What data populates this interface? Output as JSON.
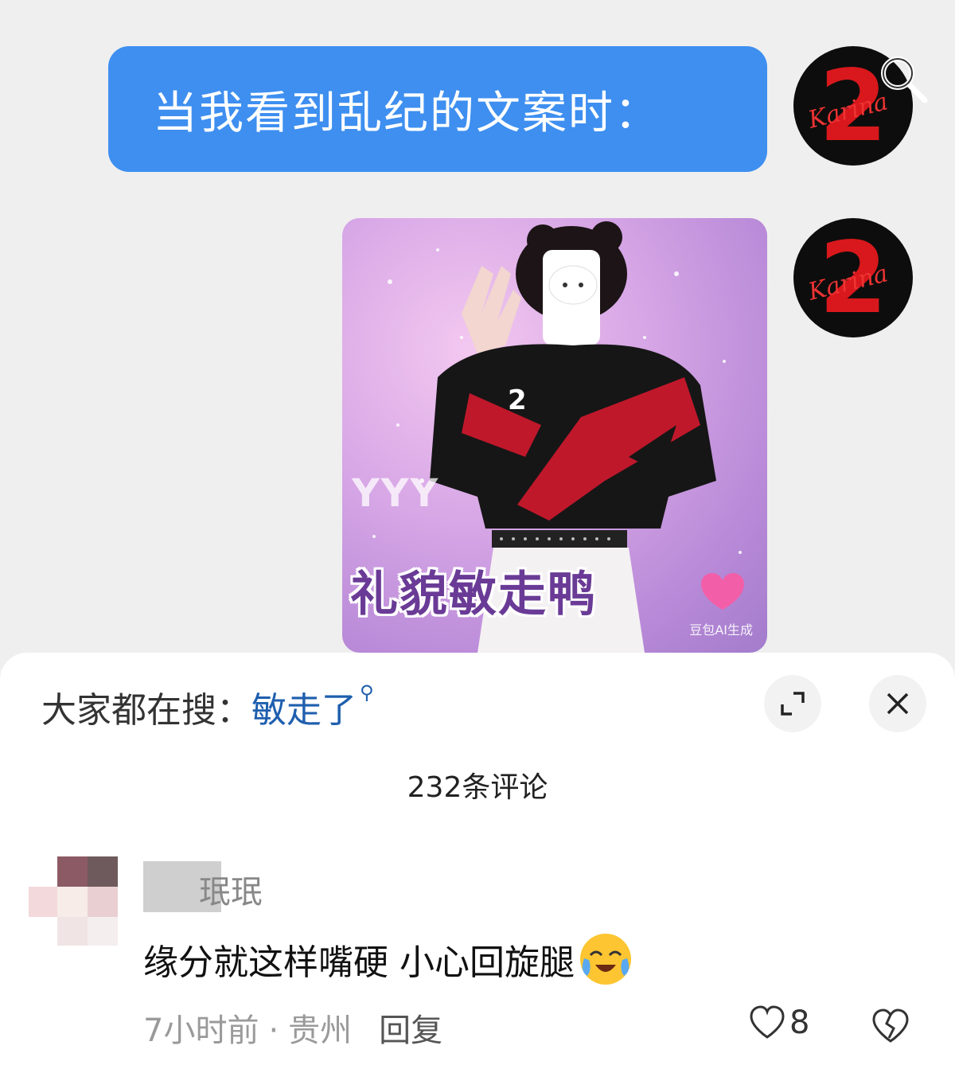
{
  "chat": {
    "message_text": "当我看到乱纪的文案时：",
    "avatar_text": "2",
    "avatar_script": "Karina",
    "sticker": {
      "watermark": "YYY",
      "caption": "礼貌敏走鸭",
      "ai_label": "豆包AI生成"
    }
  },
  "sheet": {
    "trending_prefix": "大家都在搜：",
    "trending_keyword": "敏走了",
    "comment_count": "232条评论",
    "comment": {
      "username": "珉珉",
      "text": "缘分就这样嘴硬 小心回旋腿",
      "time": "7小时前",
      "location": "贵州",
      "reply_label": "回复",
      "like_count": "8"
    }
  },
  "colors": {
    "bubble": "#3e8ff0",
    "keyword": "#1f5fae",
    "avatar_red": "#d8181c"
  },
  "icons": [
    "search-icon",
    "expand-icon",
    "close-icon",
    "heart-icon",
    "broken-heart-icon",
    "crying-laughing-emoji"
  ]
}
